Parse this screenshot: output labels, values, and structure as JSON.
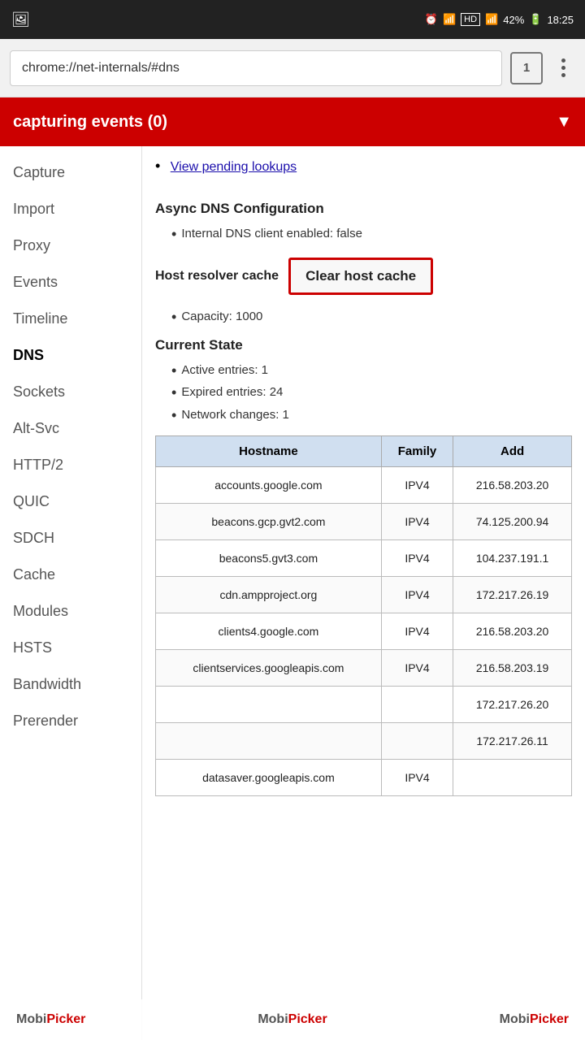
{
  "statusBar": {
    "time": "18:25",
    "battery": "42%",
    "signal": "HD"
  },
  "addressBar": {
    "url": "chrome://net-internals/#dns",
    "url_scheme": "chrome://",
    "url_host": "net-internals",
    "url_path": "/#dns",
    "tabCount": "1"
  },
  "eventsBanner": {
    "label": "capturing events (0)",
    "arrowIcon": "▼"
  },
  "sidebar": {
    "items": [
      {
        "label": "Capture",
        "active": false
      },
      {
        "label": "Import",
        "active": false
      },
      {
        "label": "Proxy",
        "active": false
      },
      {
        "label": "Events",
        "active": false
      },
      {
        "label": "Timeline",
        "active": false
      },
      {
        "label": "DNS",
        "active": true
      },
      {
        "label": "Sockets",
        "active": false
      },
      {
        "label": "Alt-Svc",
        "active": false
      },
      {
        "label": "HTTP/2",
        "active": false
      },
      {
        "label": "QUIC",
        "active": false
      },
      {
        "label": "SDCH",
        "active": false
      },
      {
        "label": "Cache",
        "active": false
      },
      {
        "label": "Modules",
        "active": false
      },
      {
        "label": "HSTS",
        "active": false
      },
      {
        "label": "Bandwidth",
        "active": false
      },
      {
        "label": "Prerender",
        "active": false
      }
    ]
  },
  "content": {
    "viewPendingLink": "View pending lookups",
    "asyncDNSHeading": "Async DNS Configuration",
    "internalDNSItem": "Internal DNS client enabled: false",
    "hostResolverLabel": "Host resolver cache",
    "clearCacheBtn": "Clear host cache",
    "capacityItem": "Capacity: 1000",
    "currentStateHeading": "Current State",
    "stateItems": [
      "Active entries: 1",
      "Expired entries: 24",
      "Network changes: 1"
    ],
    "tableHeaders": [
      "Hostname",
      "Family",
      "Add"
    ],
    "tableRows": [
      {
        "hostname": "accounts.google.com",
        "family": "IPV4",
        "address": "216.58.203.20"
      },
      {
        "hostname": "beacons.gcp.gvt2.com",
        "family": "IPV4",
        "address": "74.125.200.94"
      },
      {
        "hostname": "beacons5.gvt3.com",
        "family": "IPV4",
        "address": "104.237.191.1"
      },
      {
        "hostname": "cdn.ampproject.org",
        "family": "IPV4",
        "address": "172.217.26.19"
      },
      {
        "hostname": "clients4.google.com",
        "family": "IPV4",
        "address": "216.58.203.20"
      },
      {
        "hostname": "clientservices.googleapis.com",
        "family": "IPV4",
        "address": "216.58.203.19"
      },
      {
        "hostname": "",
        "family": "",
        "address": "172.217.26.20"
      },
      {
        "hostname": "",
        "family": "",
        "address": "172.217.26.11"
      },
      {
        "hostname": "datasaver.googleapis.com",
        "family": "IPV4",
        "address": ""
      }
    ]
  },
  "watermark": {
    "brand1": "Mobi",
    "brand2": "Picker",
    "center": "MobiPicker",
    "right": "MobiPicker"
  }
}
